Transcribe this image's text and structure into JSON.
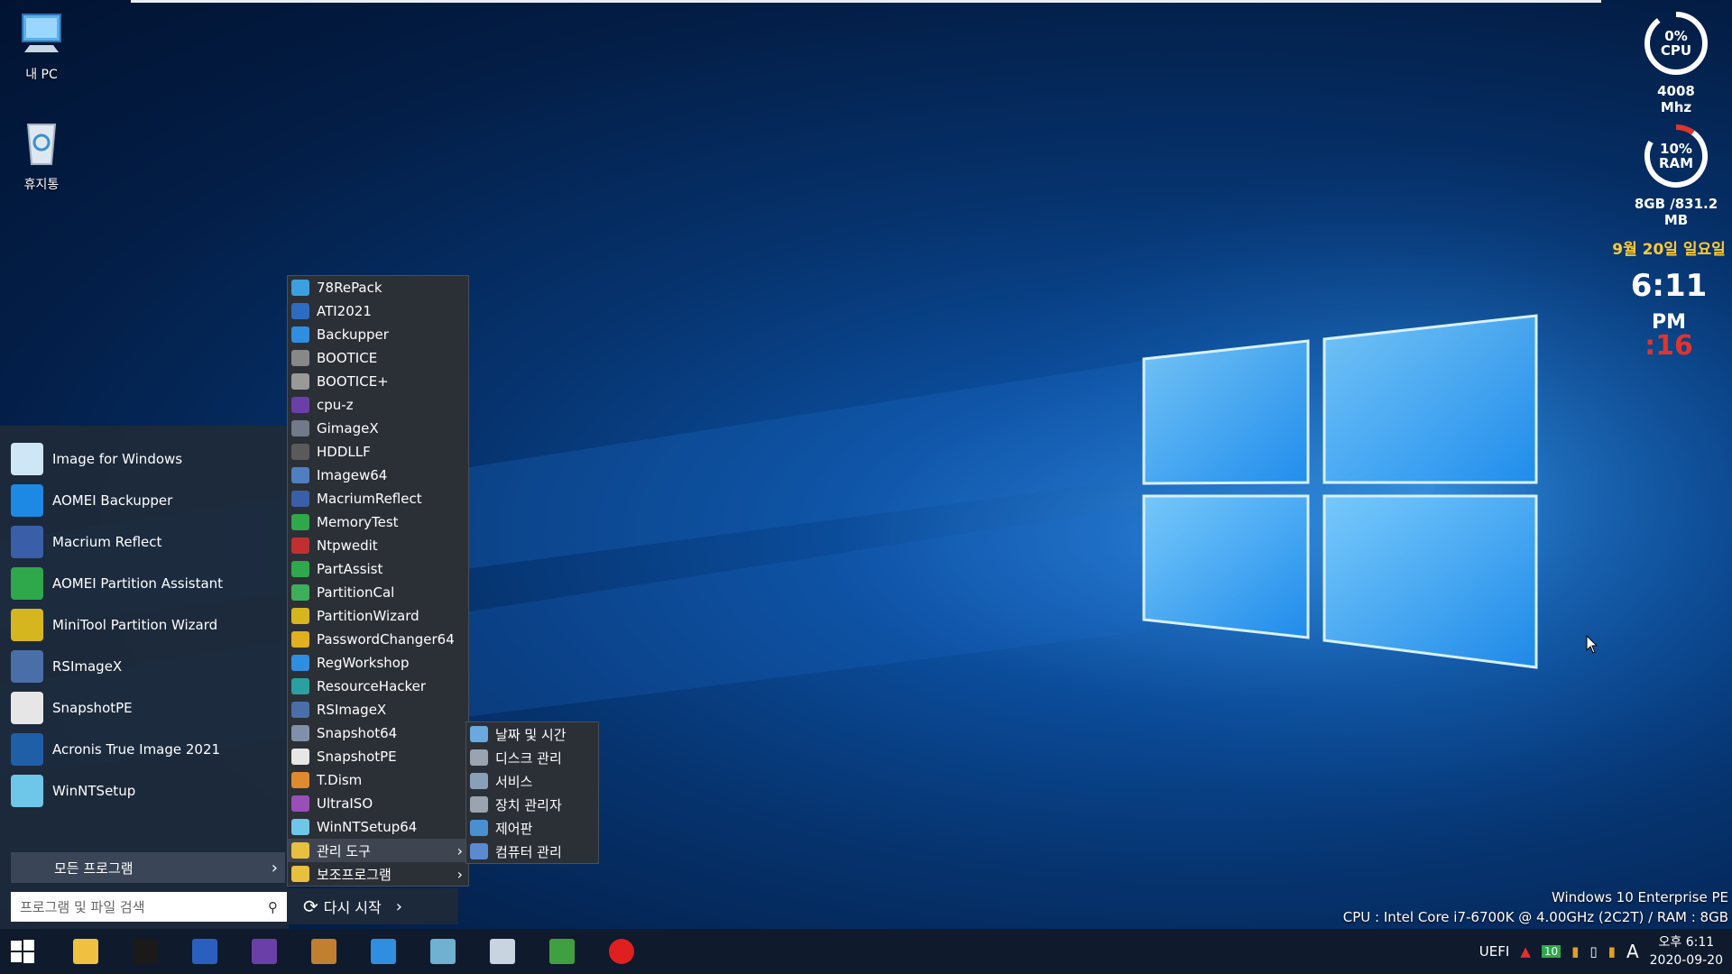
{
  "desktop": {
    "icons": [
      {
        "label": "내 PC",
        "icon": "computer-icon"
      },
      {
        "label": "휴지통",
        "icon": "recycle-bin-icon"
      }
    ]
  },
  "gadgets": {
    "cpu": {
      "percent": "0%",
      "name": "CPU",
      "freq": "4008 Mhz",
      "usage": 0
    },
    "ram": {
      "percent": "10%",
      "name": "RAM",
      "detail": "8GB /831.2 MB",
      "usage": 10
    },
    "clock": {
      "date": "9월 20일 일요일",
      "time": "6:11",
      "ampm": "PM",
      "seconds": ":16"
    }
  },
  "start_menu": {
    "pinned": [
      {
        "label": "Image for Windows",
        "icon": "image-for-windows-icon",
        "color": "#cfe6f7"
      },
      {
        "label": "AOMEI Backupper",
        "icon": "aomei-backupper-icon",
        "color": "#1e88e5"
      },
      {
        "label": "Macrium Reflect",
        "icon": "macrium-reflect-icon",
        "color": "#3a5fa8"
      },
      {
        "label": "AOMEI Partition Assistant",
        "icon": "partition-assistant-icon",
        "color": "#2ea84a"
      },
      {
        "label": "MiniTool Partition Wizard",
        "icon": "minitool-icon",
        "color": "#d6b61e"
      },
      {
        "label": "RSImageX",
        "icon": "rsimagex-icon",
        "color": "#4a6ea8"
      },
      {
        "label": "SnapshotPE",
        "icon": "snapshot-icon",
        "color": "#e6e6e6"
      },
      {
        "label": "Acronis True Image 2021",
        "icon": "acronis-icon",
        "color": "#1f5fa8"
      },
      {
        "label": "WinNTSetup",
        "icon": "winntsetup-icon",
        "color": "#6ec6e8"
      }
    ],
    "all_programs": "모든 프로그램",
    "search_placeholder": "프로그램 및 파일 검색",
    "restart_label": "다시 시작"
  },
  "programs": [
    {
      "label": "78RePack",
      "color": "#3aa0e0"
    },
    {
      "label": "ATI2021",
      "color": "#2d6cc0"
    },
    {
      "label": "Backupper",
      "color": "#2f8ee0"
    },
    {
      "label": "BOOTICE",
      "color": "#888888"
    },
    {
      "label": "BOOTICE+",
      "color": "#999999"
    },
    {
      "label": "cpu-z",
      "color": "#6a3fa8"
    },
    {
      "label": "GimageX",
      "color": "#707a88"
    },
    {
      "label": "HDDLLF",
      "color": "#5a5a5a"
    },
    {
      "label": "Imagew64",
      "color": "#4f7fc0"
    },
    {
      "label": "MacriumReflect",
      "color": "#3a5fa8"
    },
    {
      "label": "MemoryTest",
      "color": "#2ea84a"
    },
    {
      "label": "Ntpwedit",
      "color": "#c03030"
    },
    {
      "label": "PartAssist",
      "color": "#2ea84a"
    },
    {
      "label": "PartitionCal",
      "color": "#3fae5a"
    },
    {
      "label": "PartitionWizard",
      "color": "#d6b61e"
    },
    {
      "label": "PasswordChanger64",
      "color": "#e0b020"
    },
    {
      "label": "RegWorkshop",
      "color": "#2f8ee0"
    },
    {
      "label": "ResourceHacker",
      "color": "#2aa0a0"
    },
    {
      "label": "RSImageX",
      "color": "#4a6ea8"
    },
    {
      "label": "Snapshot64",
      "color": "#8090a8"
    },
    {
      "label": "SnapshotPE",
      "color": "#e6e6e6"
    },
    {
      "label": "T.Dism",
      "color": "#e08a30"
    },
    {
      "label": "UltraISO",
      "color": "#9a4fb8"
    },
    {
      "label": "WinNTSetup64",
      "color": "#6ec6e8"
    },
    {
      "label": "관리 도구",
      "color": "#e8c040",
      "submenu": true
    },
    {
      "label": "보조프로그램",
      "color": "#e8c040",
      "submenu": true
    }
  ],
  "admin_tools": [
    {
      "label": "날짜 및 시간",
      "icon": "date-time-icon",
      "color": "#6aa8e0"
    },
    {
      "label": "디스크 관리",
      "icon": "disk-management-icon",
      "color": "#9aa4b0"
    },
    {
      "label": "서비스",
      "icon": "services-icon",
      "color": "#8aa0b8"
    },
    {
      "label": "장치 관리자",
      "icon": "device-manager-icon",
      "color": "#9aa4b0"
    },
    {
      "label": "제어판",
      "icon": "control-panel-icon",
      "color": "#4a90d0"
    },
    {
      "label": "컴퓨터 관리",
      "icon": "computer-management-icon",
      "color": "#5a8ad0"
    }
  ],
  "system_info": {
    "os": "Windows 10 Enterprise PE",
    "cpu": "CPU : Intel Core i7-6700K @ 4.00GHz (2C2T) / RAM : 8GB"
  },
  "taskbar": {
    "apps": [
      {
        "name": "file-explorer-icon",
        "color": "#f0c040"
      },
      {
        "name": "command-prompt-icon",
        "color": "#1a1a1a"
      },
      {
        "name": "save-disk-icon",
        "color": "#2a5fc0"
      },
      {
        "name": "cpu-chip-icon",
        "color": "#6a3fa8"
      },
      {
        "name": "archive-icon",
        "color": "#c08030"
      },
      {
        "name": "gear-network-icon",
        "color": "#2f8ee0"
      },
      {
        "name": "eraser-icon",
        "color": "#70b0d0"
      },
      {
        "name": "calculator-icon",
        "color": "#c8d4e0"
      },
      {
        "name": "task-manager-icon",
        "color": "#40a040"
      },
      {
        "name": "power-icon",
        "color": "#e02020"
      }
    ],
    "tray": {
      "uefi": "UEFI",
      "badge": "10",
      "keyboard": "A",
      "time": "오후 6:11",
      "date": "2020-09-20"
    }
  }
}
